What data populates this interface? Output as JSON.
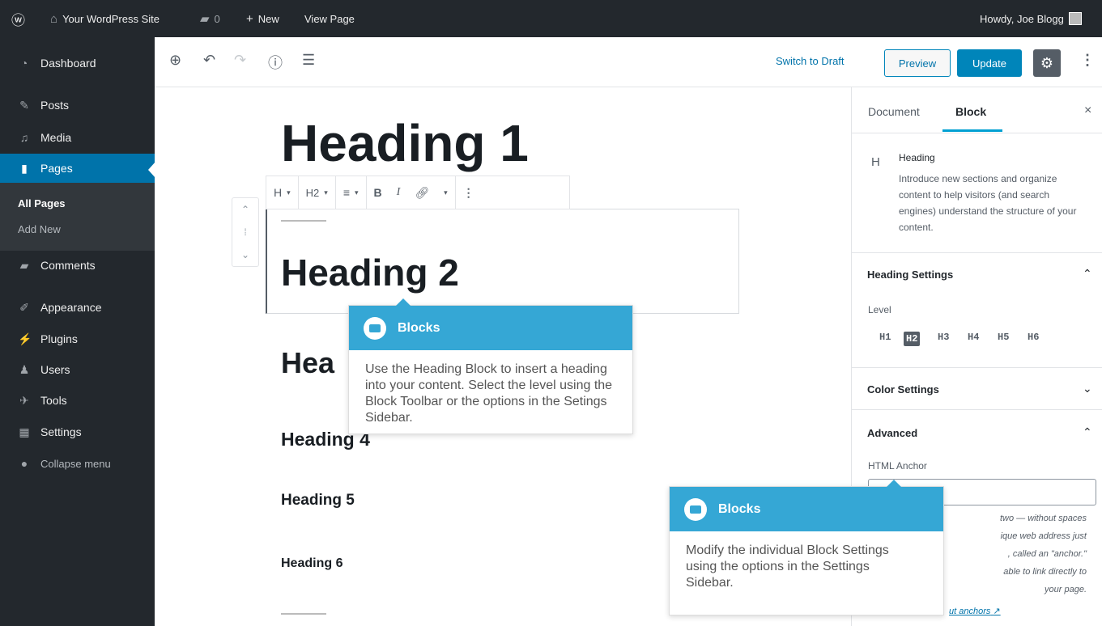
{
  "admin_bar": {
    "site_name": "Your WordPress Site",
    "comments_count": "0",
    "new_label": "New",
    "view_page": "View Page",
    "greeting": "Howdy, Joe Blogg"
  },
  "sidebar": {
    "items": [
      {
        "label": "Dashboard",
        "icon": "dashboard-icon"
      },
      {
        "label": "Posts",
        "icon": "pin-icon"
      },
      {
        "label": "Media",
        "icon": "media-icon"
      },
      {
        "label": "Pages",
        "icon": "pages-icon"
      },
      {
        "label": "Comments",
        "icon": "comment-icon"
      },
      {
        "label": "Appearance",
        "icon": "brush-icon"
      },
      {
        "label": "Plugins",
        "icon": "plug-icon"
      },
      {
        "label": "Users",
        "icon": "users-icon"
      },
      {
        "label": "Tools",
        "icon": "wrench-icon"
      },
      {
        "label": "Settings",
        "icon": "settings-icon"
      },
      {
        "label": "Collapse menu",
        "icon": "collapse-icon"
      }
    ],
    "submenu": [
      "All Pages",
      "Add New"
    ]
  },
  "toolbar": {
    "switch_to_draft": "Switch to Draft",
    "preview": "Preview",
    "update": "Update"
  },
  "block_toolbar": {
    "block_type": "H",
    "level": "H2",
    "bold": "B",
    "italic": "I"
  },
  "content": {
    "h1": "Heading 1",
    "h2": "Heading 2",
    "h3_partial": "Hea",
    "h4": "Heading 4",
    "h5": "Heading 5",
    "h6": "Heading 6"
  },
  "settings": {
    "tab_document": "Document",
    "tab_block": "Block",
    "block_name": "Heading",
    "block_icon": "H",
    "block_description": "Introduce new sections and organize content to help visitors (and search engines) understand the structure of your content.",
    "heading_settings": "Heading Settings",
    "level_label": "Level",
    "levels": [
      "H1",
      "H2",
      "H3",
      "H4",
      "H5",
      "H6"
    ],
    "active_level": "H2",
    "color_settings": "Color Settings",
    "advanced": "Advanced",
    "html_anchor": "HTML Anchor",
    "anchor_help": "two — without spaces\nique web address just\n, called an \"anchor.\"\nable to link directly to\nyour page.",
    "learn_more": "ut anchors"
  },
  "tooltips": [
    {
      "title": "Blocks",
      "text": "Use the Heading Block to insert a heading into your content. Select the level using the Block Toolbar or the options in the Setings Sidebar."
    },
    {
      "title": "Blocks",
      "text": "Modify the individual Block Settings using the options in the Settings Sidebar."
    }
  ],
  "colors": {
    "admin_dark": "#23282d",
    "accent_blue": "#0073aa",
    "tooltip_blue": "#35a7d5"
  }
}
